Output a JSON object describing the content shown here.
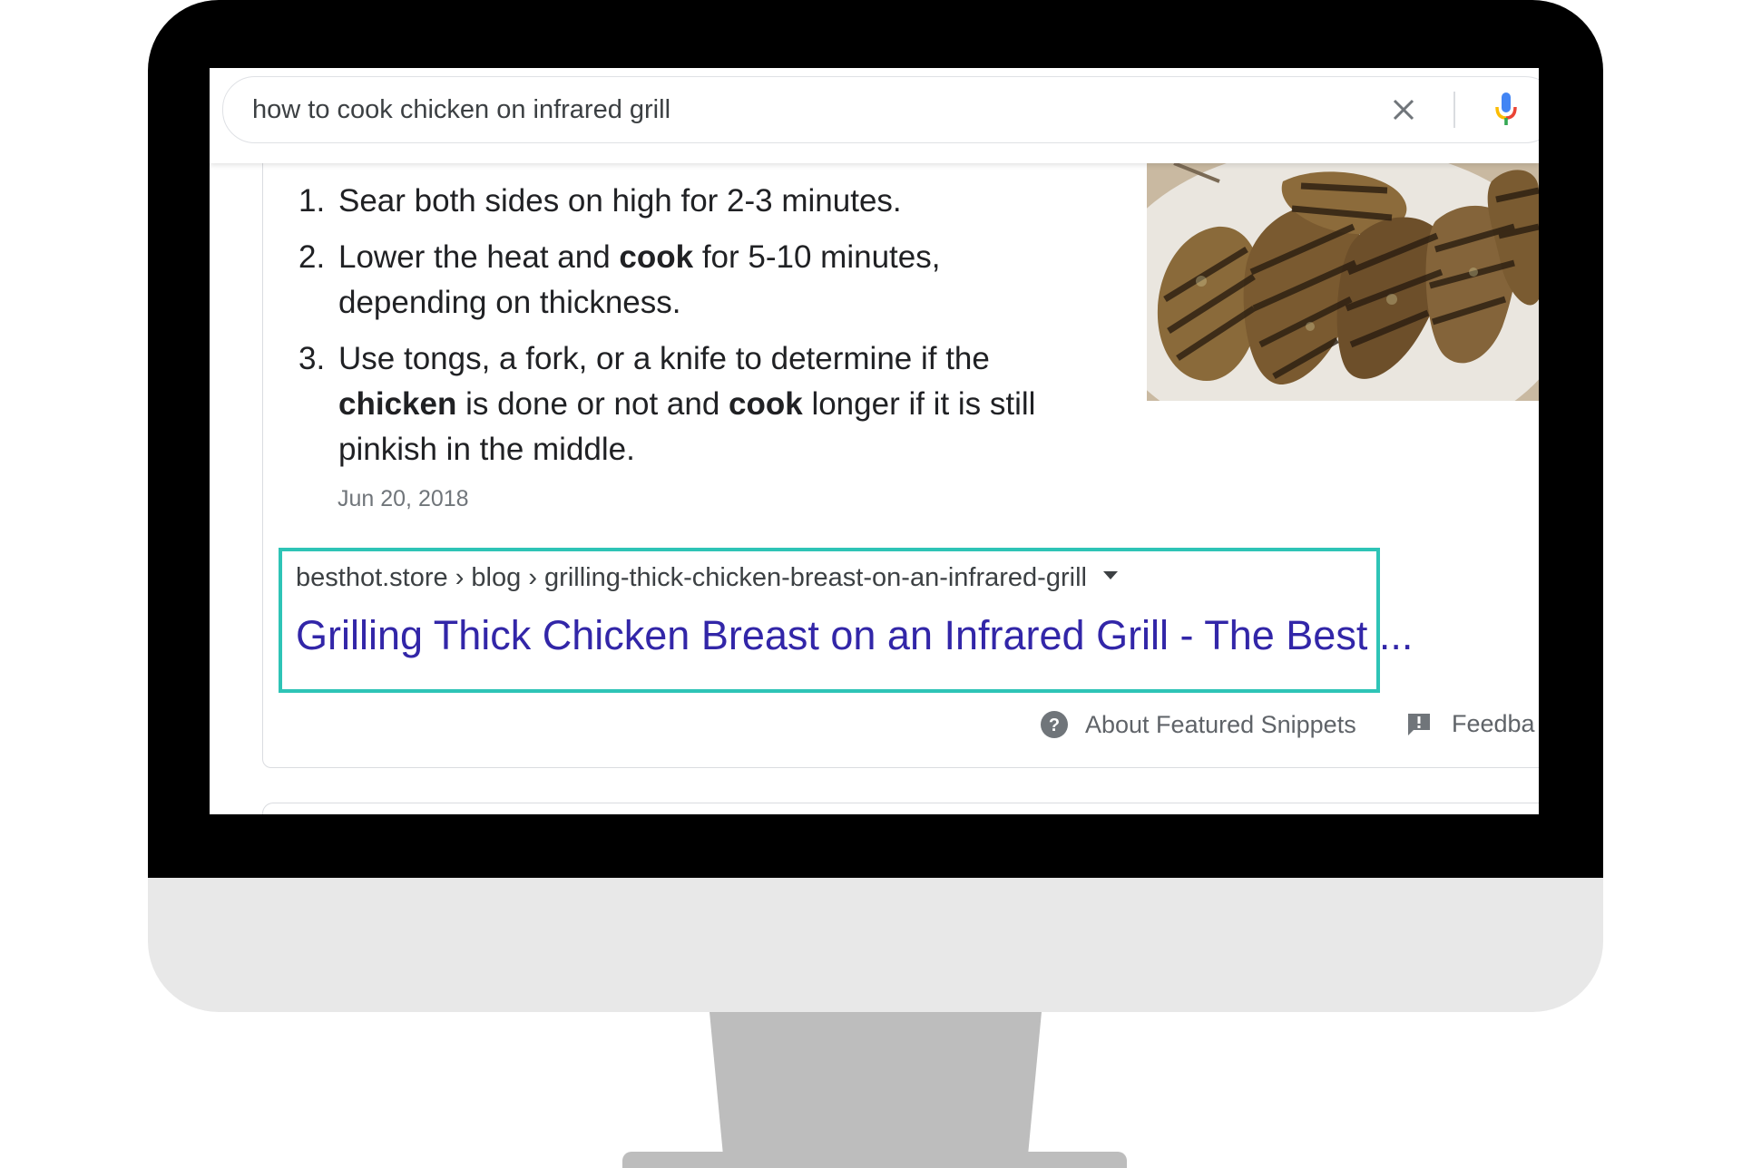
{
  "search": {
    "query": "how to cook chicken on infrared grill"
  },
  "snippet": {
    "steps": [
      {
        "number": "1.",
        "parts": [
          {
            "text": "Sear both sides on high for 2-3 minutes.",
            "bold": false
          }
        ]
      },
      {
        "number": "2.",
        "parts": [
          {
            "text": "Lower the heat and ",
            "bold": false
          },
          {
            "text": "cook",
            "bold": true
          },
          {
            "text": " for 5-10 minutes, depending on thickness.",
            "bold": false
          }
        ]
      },
      {
        "number": "3.",
        "parts": [
          {
            "text": "Use tongs, a fork, or a knife to determine if the ",
            "bold": false
          },
          {
            "text": "chicken",
            "bold": true
          },
          {
            "text": " is done or not and ",
            "bold": false
          },
          {
            "text": "cook",
            "bold": true
          },
          {
            "text": " longer if it is still pinkish in the middle.",
            "bold": false
          }
        ]
      }
    ],
    "date": "Jun 20, 2018",
    "image_subject": "grilled chicken breasts on a plate",
    "breadcrumb": "besthot.store › blog › grilling-thick-chicken-breast-on-an-infrared-grill",
    "title": "Grilling Thick Chicken Breast on an Infrared Grill - The Best ..."
  },
  "footer": {
    "about": "About Featured Snippets",
    "feedback": "Feedba"
  },
  "colors": {
    "highlight": "#2ec4b6",
    "link": "#3226a8",
    "bezel": "#000000",
    "chin": "#e8e8e8",
    "stand": "#bdbdbd"
  },
  "icons": {
    "clear": "close-icon",
    "voice": "microphone-icon",
    "about": "help-circle-icon",
    "feedback": "feedback-icon",
    "breadcrumb_menu": "caret-down-icon"
  }
}
